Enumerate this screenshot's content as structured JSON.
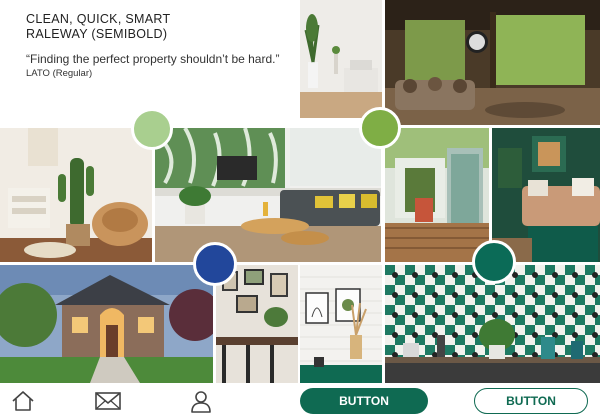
{
  "typography": {
    "heading": "CLEAN, QUICK, SMART",
    "heading_font_note": "RALEWAY (SEMIBOLD)",
    "quote": "“Finding the perfect property shouldn’t be hard.”",
    "quote_font_note": "LATO (Regular)"
  },
  "swatches": [
    {
      "name": "light-green",
      "color": "#a9cf8f"
    },
    {
      "name": "olive-green",
      "color": "#7fae45"
    },
    {
      "name": "royal-blue",
      "color": "#22479b"
    },
    {
      "name": "deep-teal",
      "color": "#0b6b57"
    }
  ],
  "nav": {
    "icons": [
      "home-icon",
      "mail-icon",
      "user-icon"
    ]
  },
  "buttons": {
    "primary_label": "BUTTON",
    "secondary_label": "BUTTON"
  },
  "colors": {
    "accent": "#0f6a52",
    "background": "#ffffff"
  }
}
